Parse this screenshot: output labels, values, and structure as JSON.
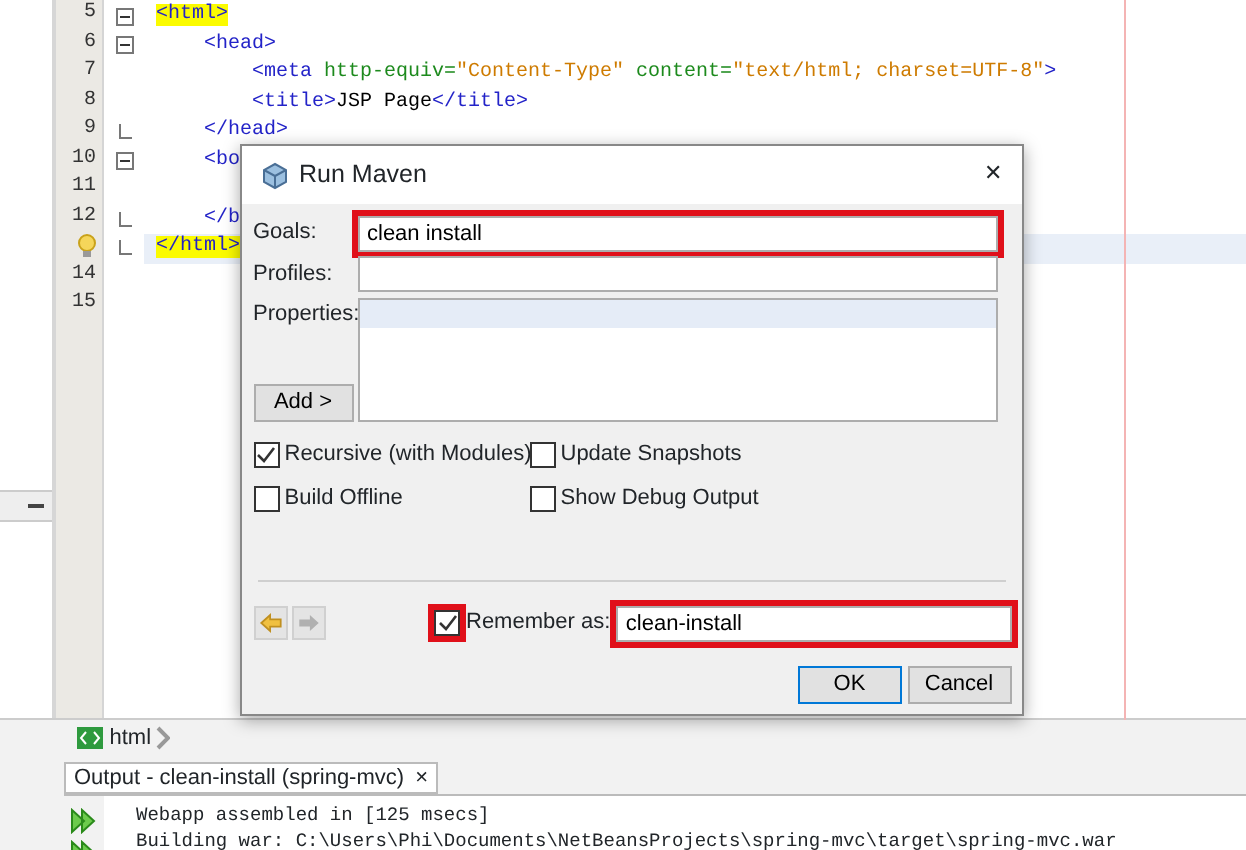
{
  "editor": {
    "lines": [
      {
        "number": "5",
        "fold_start": true,
        "tokens": [
          {
            "kind": "hl",
            "text": "<html>"
          }
        ],
        "children": [
          {
            "number": "6",
            "fold_start": true,
            "tokens": [
              {
                "kind": "tag",
                "text": "<head>"
              }
            ],
            "children": [
              {
                "number": "7",
                "tokens": [
                  {
                    "kind": "tag",
                    "text": "<meta "
                  },
                  {
                    "kind": "attr",
                    "text": "http-equiv="
                  },
                  {
                    "kind": "value",
                    "text": "\"Content-Type\" "
                  },
                  {
                    "kind": "attr",
                    "text": "content="
                  },
                  {
                    "kind": "value",
                    "text": "\"text/html; charset=UTF-8\""
                  },
                  {
                    "kind": "tag",
                    "text": ">"
                  }
                ]
              },
              {
                "number": "8",
                "tokens": [
                  {
                    "kind": "tag",
                    "text": "<title>"
                  },
                  {
                    "kind": "text",
                    "text": "JSP Page"
                  },
                  {
                    "kind": "tag",
                    "text": "</title>"
                  }
                ]
              }
            ]
          },
          {
            "number": "9",
            "fold_end": true,
            "tokens": [
              {
                "kind": "tag",
                "text": "</head>"
              }
            ]
          },
          {
            "number": "10",
            "fold_start": true,
            "tokens": [
              {
                "kind": "tag",
                "text": "<bo"
              }
            ],
            "children": [
              {
                "number": "11"
              }
            ]
          },
          {
            "number": "12",
            "fold_end": true,
            "tokens": [
              {
                "kind": "tag",
                "text": "</b"
              }
            ]
          }
        ]
      },
      {
        "bulb": true,
        "current": true,
        "fold_end": true,
        "tokens": [
          {
            "kind": "hl",
            "text": "</html>"
          }
        ]
      },
      {
        "number": "14"
      },
      {
        "number": "15"
      }
    ]
  },
  "breadcrumb": {
    "label": "html"
  },
  "output": {
    "tab": {
      "label": "Output - clean-install (spring-mvc)",
      "close": "×"
    },
    "lines": [
      "Webapp assembled in [125 msecs]",
      "Building war: C:\\Users\\Phi\\Documents\\NetBeansProjects\\spring-mvc\\target\\spring-mvc.war"
    ]
  },
  "dialog": {
    "title": "Run Maven",
    "close": "✕",
    "goals": {
      "label": "Goals:",
      "value": "clean install",
      "highlighted": true
    },
    "profiles": {
      "label": "Profiles:",
      "highlighted": false
    },
    "properties": {
      "label": "Properties:"
    },
    "add_button": "Add >",
    "options": [
      {
        "label": "Recursive (with Modules)",
        "checked": true
      },
      {
        "label": "Update Snapshots",
        "checked": false
      },
      {
        "label": "Build Offline",
        "checked": false
      },
      {
        "label": "Show Debug Output",
        "checked": false
      }
    ],
    "remember": {
      "label": "Remember as:",
      "checked": true,
      "checkbox_highlighted": true,
      "value": "clean-install",
      "field_highlighted": true
    },
    "buttons": [
      {
        "label": "OK",
        "default": true
      },
      {
        "label": "Cancel",
        "default": false
      }
    ]
  }
}
